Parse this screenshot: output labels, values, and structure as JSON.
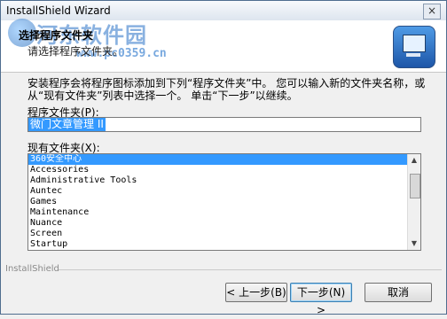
{
  "window": {
    "title": "InstallShield Wizard",
    "close_label": "×"
  },
  "watermark": {
    "text": "河东软件园",
    "url": "www.pc0359.cn"
  },
  "header": {
    "title": "选择程序文件夹",
    "subtitle": "请选择程序文件夹。",
    "icon": "installer-computer-icon"
  },
  "instructions": "安装程序会将程序图标添加到下列“程序文件夹”中。 您可以输入新的文件夹名称，或从“现有文件夹”列表中选择一个。 单击“下一步”以继续。",
  "program_folder": {
    "label": "程序文件夹(P):",
    "value": "微门文章管理 II"
  },
  "existing_folders": {
    "label": "现有文件夹(X):",
    "selected_index": 0,
    "items": [
      "360安全中心",
      "Accessories",
      "Administrative Tools",
      "Auntec",
      "Games",
      "Maintenance",
      "Nuance",
      "Screen",
      "Startup"
    ]
  },
  "footer": {
    "brand": "InstallShield"
  },
  "buttons": {
    "back": "< 上一步(B)",
    "next": "下一步(N) >",
    "cancel": "取消"
  },
  "colors": {
    "selection": "#3399ff",
    "watermark": "#2a73c8"
  }
}
